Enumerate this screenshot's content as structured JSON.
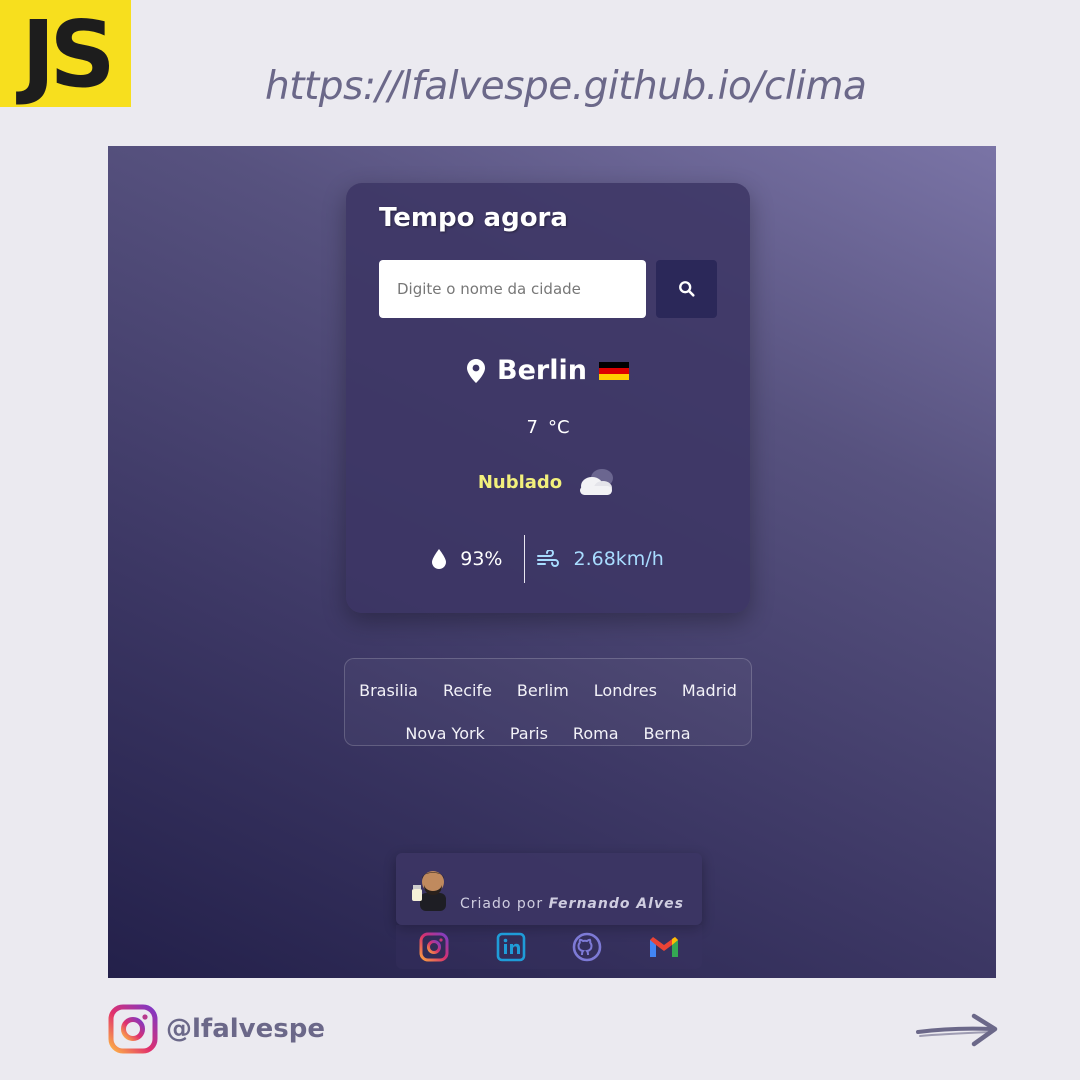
{
  "banner": {
    "logo_text": "JS",
    "url": "https://lfalvespe.github.io/clima"
  },
  "card": {
    "title": "Tempo agora",
    "search": {
      "placeholder": "Digite o nome da cidade",
      "value": "",
      "button_icon": "search-icon"
    },
    "city": "Berlin",
    "flag_icon": "flag-germany-icon",
    "temperature": "7",
    "temperature_unit": "°C",
    "description": "Nublado",
    "weather_icon": "cloudy-icon",
    "humidity": "93%",
    "wind": "2.68km/h"
  },
  "suggestions": {
    "row1": [
      "Brasilia",
      "Recife",
      "Berlim",
      "Londres",
      "Madrid"
    ],
    "row2": [
      "Nova York",
      "Paris",
      "Roma",
      "Berna"
    ]
  },
  "footer": {
    "credit_prefix": "Criado por",
    "credit_name": "Fernando Alves",
    "socials": [
      "instagram-icon",
      "linkedin-icon",
      "github-icon",
      "gmail-icon"
    ]
  },
  "post": {
    "handle": "@lfalvespe"
  },
  "colors": {
    "js_yellow": "#f7df1e",
    "description_yellow": "#f2f07c",
    "wind_blue": "#a8dcff",
    "search_button": "#2b2859"
  }
}
